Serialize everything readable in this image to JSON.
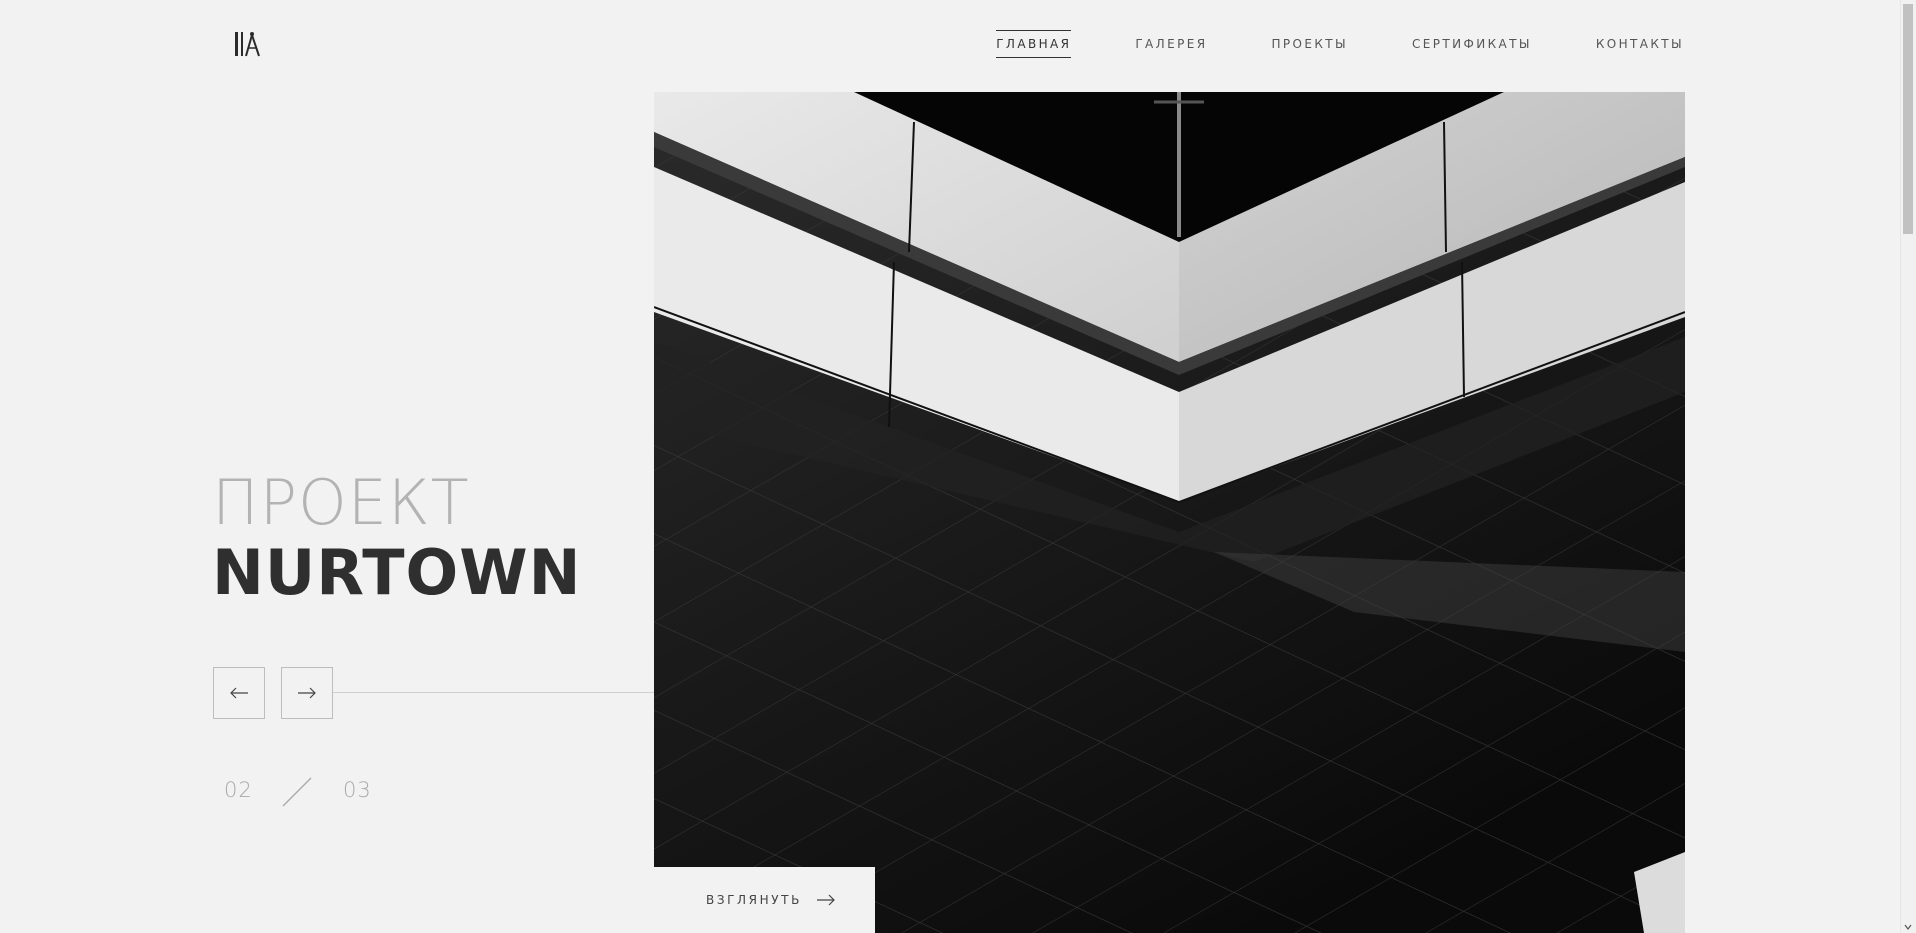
{
  "logo": {
    "icon": "architect-compass-logo-icon"
  },
  "nav": {
    "items": [
      {
        "label": "ГЛАВНАЯ",
        "active": true
      },
      {
        "label": "ГАЛЕРЕЯ",
        "active": false
      },
      {
        "label": "ПРОЕКТЫ",
        "active": false
      },
      {
        "label": "СЕРТИФИКАТЫ",
        "active": false
      },
      {
        "label": "КОНТАКТЫ",
        "active": false
      }
    ]
  },
  "hero": {
    "title_light": "ПРОЕКТ",
    "title_bold": "NURTOWN",
    "prev_icon": "arrow-left-icon",
    "next_icon": "arrow-right-icon",
    "counter": {
      "current": "02",
      "total": "03"
    },
    "cta_label": "ВЗГЛЯНУТЬ",
    "cta_icon": "arrow-right-icon",
    "image": "black-and-white-architecture-photo"
  },
  "colors": {
    "background": "#f2f2f2",
    "text": "#333333",
    "muted": "#b3b3b3"
  }
}
